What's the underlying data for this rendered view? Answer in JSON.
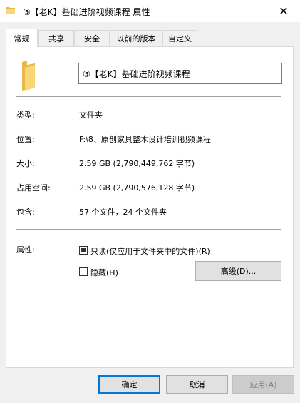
{
  "window": {
    "title": "⑤【老K】基础进阶视频课程 属性",
    "close_glyph": "✕"
  },
  "tabs": [
    {
      "label": "常规",
      "active": true
    },
    {
      "label": "共享",
      "active": false
    },
    {
      "label": "安全",
      "active": false
    },
    {
      "label": "以前的版本",
      "active": false
    },
    {
      "label": "自定义",
      "active": false
    }
  ],
  "general": {
    "name": "⑤【老K】基础进阶视频课程",
    "properties": [
      {
        "label": "类型:",
        "value": "文件夹"
      },
      {
        "label": "位置:",
        "value": "F:\\8、原创家具整木设计培训视频课程"
      },
      {
        "label": "大小:",
        "value": "2.59 GB (2,790,449,762 字节)"
      },
      {
        "label": "占用空间:",
        "value": "2.59 GB (2,790,576,128 字节)"
      },
      {
        "label": "包含:",
        "value": "57 个文件，24 个文件夹"
      }
    ],
    "attributes_label": "属性:",
    "readonly_label": "只读(仅应用于文件夹中的文件)(R)",
    "readonly_state": "indeterminate",
    "hidden_label": "隐藏(H)",
    "hidden_checked": false,
    "advanced_label": "高级(D)..."
  },
  "footer": {
    "ok_label": "确定",
    "cancel_label": "取消",
    "apply_label": "应用(A)"
  },
  "colors": {
    "folder": "#f8d775",
    "accent": "#0078d7"
  }
}
